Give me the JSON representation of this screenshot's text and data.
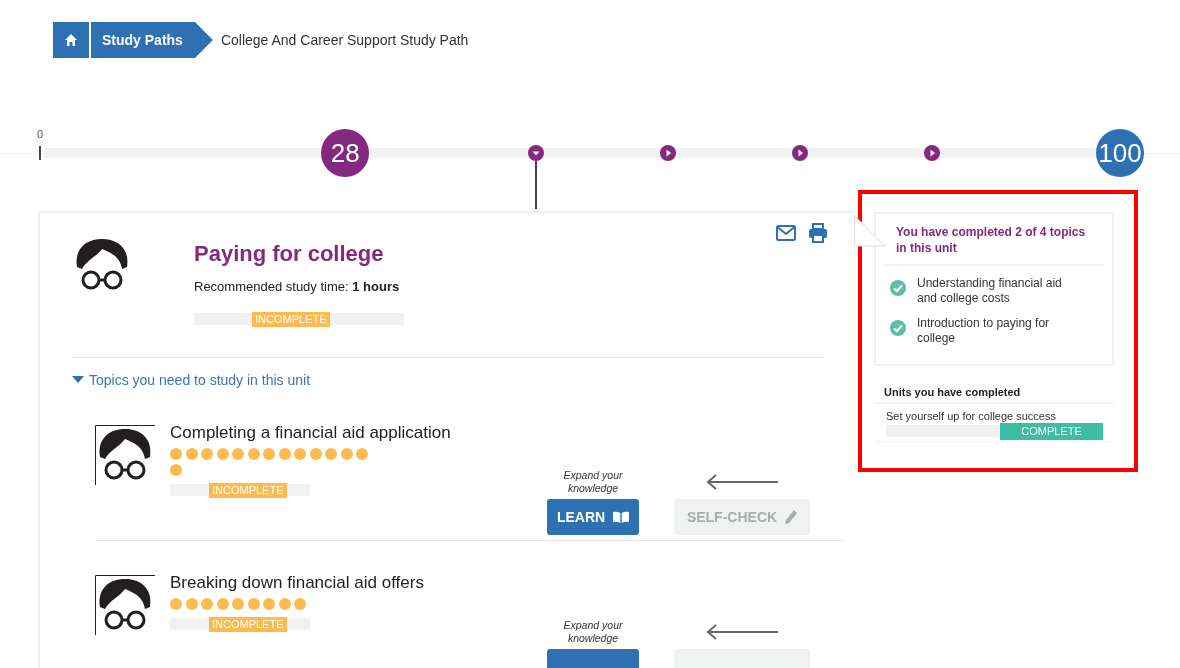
{
  "breadcrumb": {
    "items": [
      {
        "kind": "home"
      },
      {
        "kind": "link",
        "label": "Study Paths"
      },
      {
        "kind": "current",
        "label": "College And Career Support Study Path"
      }
    ]
  },
  "timeline": {
    "start_label": "0",
    "level": 0.28,
    "progress_label": "28",
    "milestones": [
      {
        "kind": "current"
      },
      {
        "kind": "upcoming"
      },
      {
        "kind": "upcoming"
      },
      {
        "kind": "upcoming"
      }
    ],
    "end_badge": "100"
  },
  "unit": {
    "title": "Paying for college",
    "study_time_label": "Recommended study time:",
    "study_time": "1 hours",
    "status": "INCOMPLETE",
    "complete": false,
    "topics_toggle": {
      "label": "Topics you need to study in this unit",
      "expanded": true
    },
    "topics": [
      {
        "title": "Completing a financial aid application",
        "dots": [
          {
            "filled": true
          },
          {
            "filled": true
          },
          {
            "filled": true
          },
          {
            "filled": true
          },
          {
            "filled": true
          },
          {
            "filled": true
          },
          {
            "filled": true
          },
          {
            "filled": true
          },
          {
            "filled": true
          },
          {
            "filled": true
          },
          {
            "filled": true
          },
          {
            "filled": true
          },
          {
            "filled": true
          },
          {
            "filled": true
          }
        ],
        "status": "INCOMPLETE",
        "complete": false,
        "hint": "Expand your knowledge",
        "learn": "LEARN",
        "self_check": {
          "label": "SELF-CHECK",
          "disabled": true
        }
      },
      {
        "title": "Breaking down financial aid offers",
        "dots": [
          {
            "filled": true
          },
          {
            "filled": true
          },
          {
            "filled": true
          },
          {
            "filled": true
          },
          {
            "filled": true
          },
          {
            "filled": true
          },
          {
            "filled": true
          },
          {
            "filled": true
          },
          {
            "filled": true
          }
        ],
        "status": "INCOMPLETE",
        "complete": false,
        "hint": "Expand your knowledge",
        "self_check": {
          "disabled": true
        }
      }
    ]
  },
  "sidebar": {
    "highlighted": true,
    "summary": "You have completed 2 of 4 topics in this unit",
    "completed_topics": [
      {
        "label": "Understanding financial aid and college costs",
        "checked": true
      },
      {
        "label": "Introduction to paying for college",
        "checked": true
      }
    ],
    "units_heading": "Units you have completed",
    "units": [
      {
        "title": "Set yourself up for college success",
        "status": "COMPLETE",
        "complete": true
      }
    ]
  }
}
